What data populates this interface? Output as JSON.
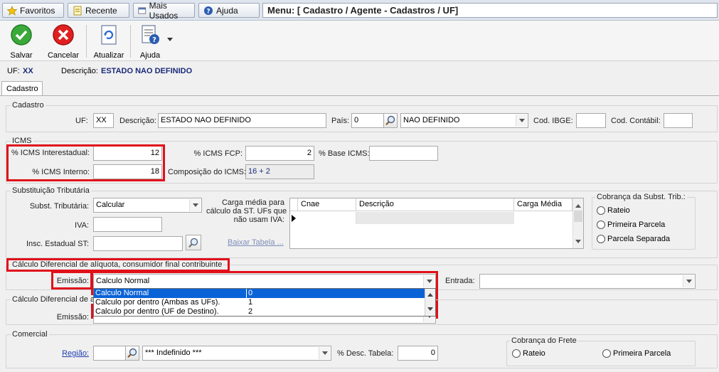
{
  "nav": {
    "favoritos": "Favoritos",
    "recente": "Recente",
    "mais_usados": "Mais Usados",
    "ajuda": "Ajuda",
    "menu_path": "Menu: [ Cadastro / Agente - Cadastros / UF]"
  },
  "toolbar": {
    "salvar": "Salvar",
    "cancelar": "Cancelar",
    "atualizar": "Atualizar",
    "ajuda": "Ajuda"
  },
  "record": {
    "uf_label": "UF:",
    "uf_value": "XX",
    "desc_label": "Descrição:",
    "desc_value": "ESTADO NAO DEFINIDO"
  },
  "tab": "Cadastro",
  "cadastro": {
    "title": "Cadastro",
    "uf_label": "UF:",
    "uf_value": "XX",
    "descricao_label": "Descrição:",
    "descricao_value": "ESTADO NAO DEFINIDO",
    "pais_label": "País:",
    "pais_code": "0",
    "pais_name": "NAO DEFINIDO",
    "ibge_label": "Cod. IBGE:",
    "ibge_value": "",
    "contabil_label": "Cod. Contábil:",
    "contabil_value": ""
  },
  "icms": {
    "title": "ICMS",
    "interestadual_label": "% ICMS Interestadual:",
    "interestadual_value": "12",
    "interno_label": "% ICMS Interno:",
    "interno_value": "18",
    "fcp_label": "% ICMS FCP:",
    "fcp_value": "2",
    "base_label": "% Base ICMS:",
    "base_value": "",
    "composicao_label": "Composição do ICMS:",
    "composicao_value": "16 + 2"
  },
  "st": {
    "title": "Substituição Tributária",
    "subst_label": "Subst. Tributária:",
    "subst_value": "Calcular",
    "iva_label": "IVA:",
    "iva_value": "",
    "insc_label": "Insc. Estadual ST:",
    "insc_value": "",
    "carga_label_1": "Carga média para",
    "carga_label_2": "cálculo da ST. UFs que",
    "carga_label_3": "não usam IVA:",
    "baixar": "Baixar Tabela ...",
    "grid_headers": [
      "Cnae",
      "Descrição",
      "Carga Média"
    ],
    "cobranca_title": "Cobrança da Subst. Trib.:",
    "cobranca_options": [
      "Rateio",
      "Primeira Parcela",
      "Parcela Separada"
    ]
  },
  "difal_contrib": {
    "title": "Cálculo Diferencial de alíquota, consumidor final contribuinte",
    "emissao_label": "Emissão:",
    "emissao_value": "Calculo Normal",
    "entrada_label": "Entrada:",
    "entrada_value": ""
  },
  "difal_nc": {
    "title": "Cálculo Diferencial de alí",
    "emissao_label": "Emissão:"
  },
  "dropdown": {
    "options": [
      {
        "label": "Calculo Normal",
        "code": "0"
      },
      {
        "label": "Calculo por dentro (Ambas as UFs).",
        "code": "1"
      },
      {
        "label": "Calculo por dentro (UF de Destino).",
        "code": "2"
      }
    ],
    "selected_index": 0
  },
  "comercial": {
    "title": "Comercial",
    "regiao_label": "Região:",
    "regiao_code": "",
    "regiao_name": "*** Indefinido ***",
    "desc_tabela_label": "% Desc. Tabela:",
    "desc_tabela_value": "0",
    "frete_title": "Cobrança do Frete",
    "frete_options": [
      "Rateio",
      "Primeira Parcela"
    ]
  },
  "colors": {
    "highlight": "#e0101b",
    "selection": "#0a63d6",
    "link": "#1f3fb0"
  }
}
